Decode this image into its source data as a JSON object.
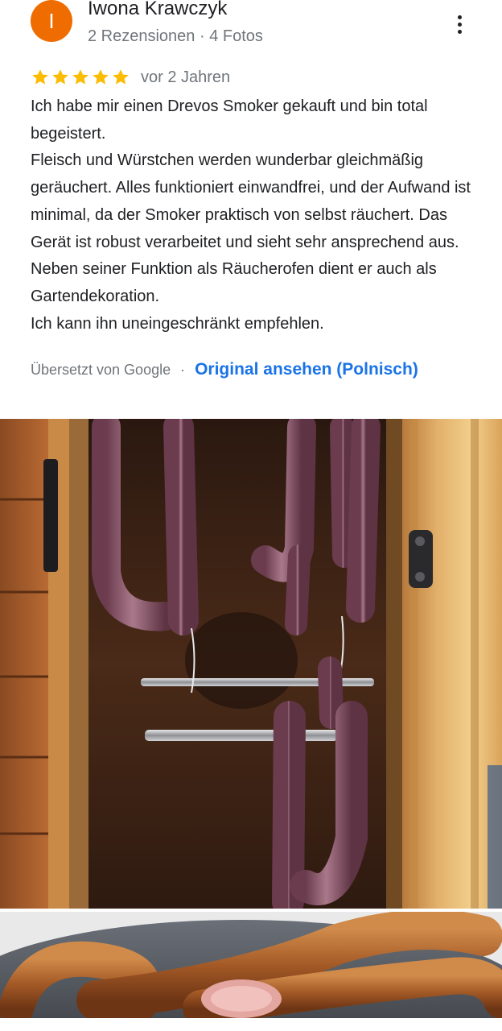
{
  "review": {
    "avatar_letter": "I",
    "author": "Iwona Krawczyk",
    "meta": "2 Rezensionen · 4 Fotos",
    "rating": 5,
    "rating_max": 5,
    "time": "vor 2 Jahren",
    "paragraphs": [
      "Ich habe mir einen Drevos Smoker gekauft und bin total begeistert.",
      "Fleisch und Würstchen werden wunderbar gleichmäßig geräuchert. Alles funktioniert einwandfrei, und der Aufwand ist minimal, da der Smoker praktisch von selbst räuchert. Das Gerät ist robust verarbeitet und sieht sehr ansprechend aus. Neben seiner Funktion als Räucherofen dient er auch als Gartendekoration.",
      "Ich kann ihn uneingeschränkt empfehlen."
    ],
    "translated_by": "Übersetzt von Google",
    "separator": "·",
    "view_original": "Original ansehen (Polnisch)"
  },
  "colors": {
    "avatar": "#ef6c00",
    "star": "#fbbc04",
    "link": "#1a73e8",
    "secondary_text": "#70757a"
  },
  "icons": {
    "more": "more-vert-icon",
    "star": "star-icon"
  },
  "photos": [
    {
      "subject": "smoker-with-hanging-sausages"
    },
    {
      "subject": "smoked-sausages-on-plate"
    }
  ]
}
